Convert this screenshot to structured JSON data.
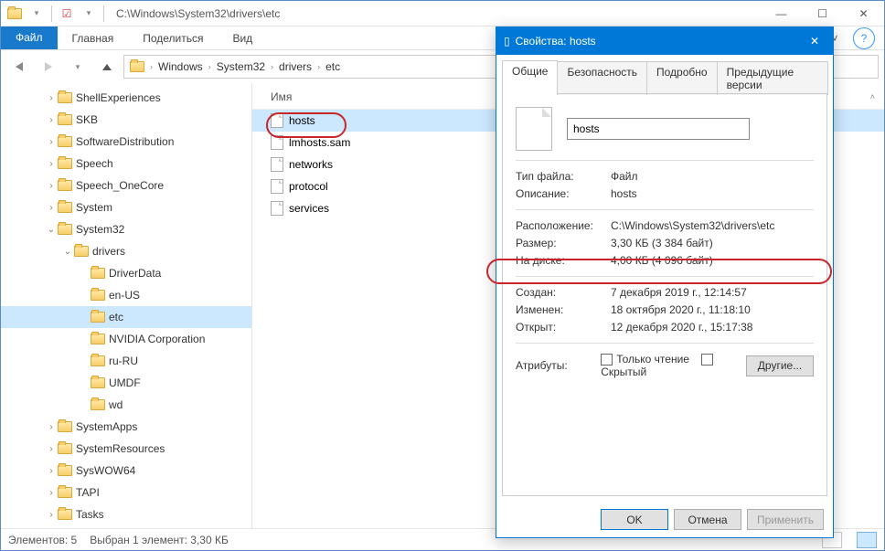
{
  "titlebar": {
    "path": "C:\\Windows\\System32\\drivers\\etc"
  },
  "ribbon": {
    "file": "Файл",
    "tabs": [
      "Главная",
      "Поделиться",
      "Вид"
    ]
  },
  "breadcrumb": [
    "Windows",
    "System32",
    "drivers",
    "etc"
  ],
  "tree": [
    {
      "ind": 40,
      "exp": "›",
      "label": "ShellExperiences"
    },
    {
      "ind": 40,
      "exp": "›",
      "label": "SKB"
    },
    {
      "ind": 40,
      "exp": "›",
      "label": "SoftwareDistribution"
    },
    {
      "ind": 40,
      "exp": "›",
      "label": "Speech"
    },
    {
      "ind": 40,
      "exp": "›",
      "label": "Speech_OneCore"
    },
    {
      "ind": 40,
      "exp": "›",
      "label": "System"
    },
    {
      "ind": 40,
      "exp": "⌄",
      "label": "System32"
    },
    {
      "ind": 58,
      "exp": "⌄",
      "label": "drivers"
    },
    {
      "ind": 76,
      "exp": "",
      "label": "DriverData"
    },
    {
      "ind": 76,
      "exp": "",
      "label": "en-US"
    },
    {
      "ind": 76,
      "exp": "",
      "label": "etc",
      "sel": true
    },
    {
      "ind": 76,
      "exp": "",
      "label": "NVIDIA Corporation"
    },
    {
      "ind": 76,
      "exp": "",
      "label": "ru-RU"
    },
    {
      "ind": 76,
      "exp": "",
      "label": "UMDF"
    },
    {
      "ind": 76,
      "exp": "",
      "label": "wd"
    },
    {
      "ind": 40,
      "exp": "›",
      "label": "SystemApps"
    },
    {
      "ind": 40,
      "exp": "›",
      "label": "SystemResources"
    },
    {
      "ind": 40,
      "exp": "›",
      "label": "SysWOW64"
    },
    {
      "ind": 40,
      "exp": "›",
      "label": "TAPI"
    },
    {
      "ind": 40,
      "exp": "›",
      "label": "Tasks"
    }
  ],
  "files": {
    "header": "Имя",
    "items": [
      "hosts",
      "lmhosts.sam",
      "networks",
      "protocol",
      "services"
    ]
  },
  "status": {
    "count": "Элементов: 5",
    "sel": "Выбран 1 элемент: 3,30 КБ"
  },
  "dialog": {
    "title": "Свойства: hosts",
    "tabs": [
      "Общие",
      "Безопасность",
      "Подробно",
      "Предыдущие версии"
    ],
    "filename": "hosts",
    "rows": {
      "type_k": "Тип файла:",
      "type_v": "Файл",
      "desc_k": "Описание:",
      "desc_v": "hosts",
      "loc_k": "Расположение:",
      "loc_v": "C:\\Windows\\System32\\drivers\\etc",
      "size_k": "Размер:",
      "size_v": "3,30 КБ (3 384 байт)",
      "disk_k": "На диске:",
      "disk_v": "4,00 КБ (4 096 байт)",
      "created_k": "Создан:",
      "created_v": "7 декабря 2019 г., 12:14:57",
      "modified_k": "Изменен:",
      "modified_v": "18 октября 2020 г., 11:18:10",
      "opened_k": "Открыт:",
      "opened_v": "12 декабря 2020 г., 15:17:38",
      "attr_k": "Атрибуты:",
      "readonly": "Только чтение",
      "hidden": "Скрытый",
      "other": "Другие..."
    },
    "buttons": {
      "ok": "OK",
      "cancel": "Отмена",
      "apply": "Применить"
    }
  }
}
